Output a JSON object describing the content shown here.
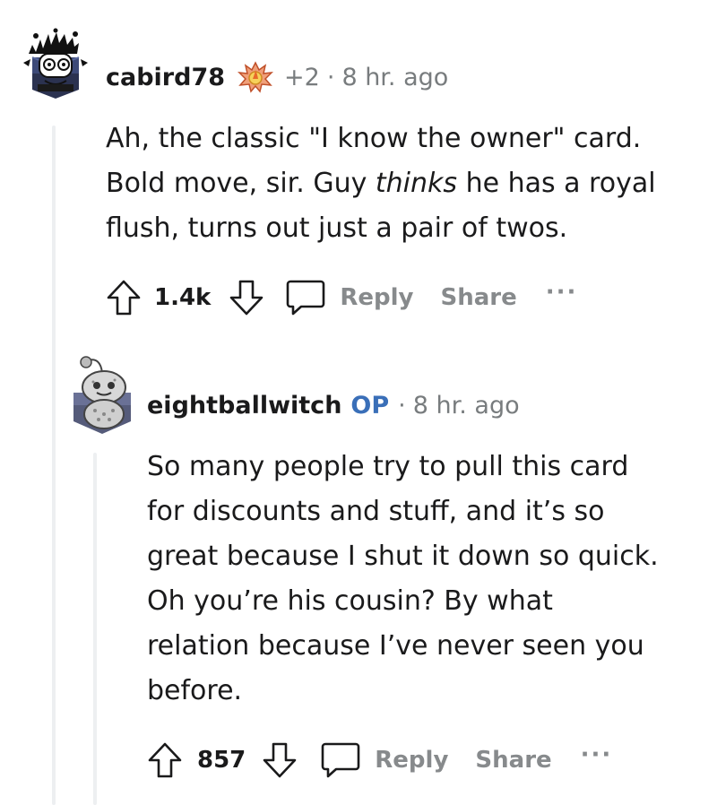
{
  "comments": [
    {
      "username": "cabird78",
      "award_count": "+2",
      "separator": "·",
      "time": "8 hr. ago",
      "body_lines": [
        {
          "pre": "Ah, the classic \"I know the owner\" card.",
          "em": "",
          "post": ""
        },
        {
          "pre": "Bold move, sir. Guy ",
          "em": "thinks",
          "post": " he has a royal"
        },
        {
          "pre": "flush, turns out just a pair of twos.",
          "em": "",
          "post": ""
        }
      ],
      "score": "1.4k",
      "reply_label": "Reply",
      "share_label": "Share",
      "more_label": "···"
    },
    {
      "username": "eightballwitch",
      "op_badge": "OP",
      "separator": "·",
      "time": "8 hr. ago",
      "body_lines": [
        "So many people try to pull this card",
        "for discounts and stuff, and it’s so",
        "great because I shut it down so quick.",
        "Oh you’re his cousin? By what",
        "relation because I’ve never seen you",
        "before."
      ],
      "score": "857",
      "reply_label": "Reply",
      "share_label": "Share",
      "more_label": "···"
    }
  ],
  "colors": {
    "op_badge": "#3a6fb8",
    "muted": "#787c7e",
    "thread_line": "#edeff1"
  },
  "icons": {
    "upvote": "arrow-up-outline-icon",
    "downvote": "arrow-down-outline-icon",
    "reply": "speech-bubble-icon",
    "award": "fire-award-icon"
  }
}
